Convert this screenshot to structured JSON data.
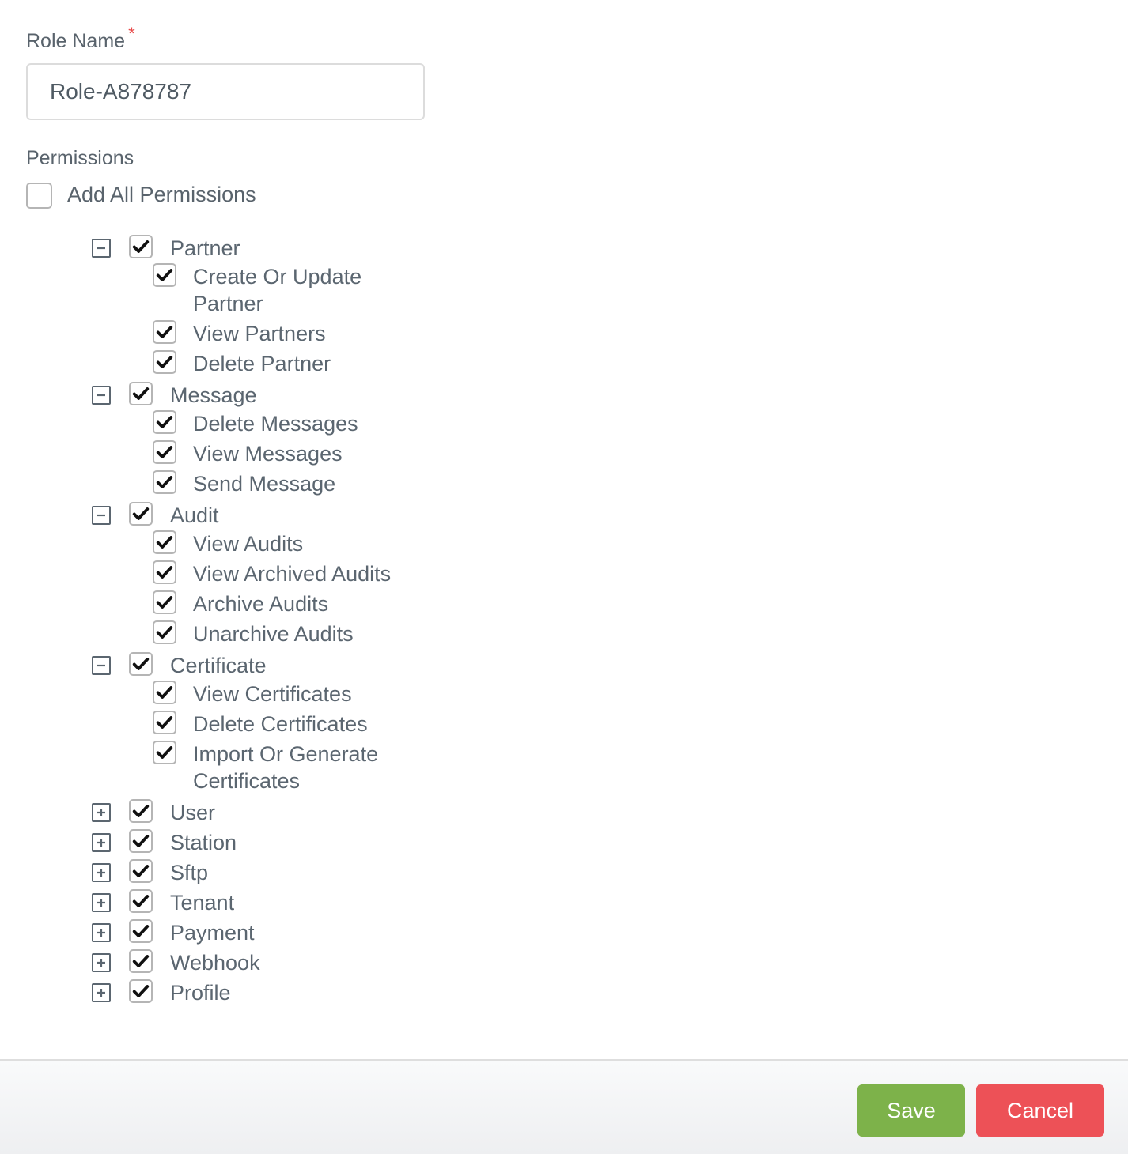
{
  "role_name": {
    "label": "Role Name",
    "required_marker": "*",
    "value": "Role-A878787"
  },
  "permissions": {
    "label": "Permissions",
    "add_all": {
      "label": "Add All Permissions",
      "checked": false
    },
    "groups": [
      {
        "label": "Partner",
        "expanded": true,
        "checked": true,
        "children": [
          {
            "label_lines": [
              "Create Or Update",
              "Partner"
            ],
            "checked": true
          },
          {
            "label_lines": [
              "View Partners"
            ],
            "checked": true
          },
          {
            "label_lines": [
              "Delete Partner"
            ],
            "checked": true
          }
        ]
      },
      {
        "label": "Message",
        "expanded": true,
        "checked": true,
        "children": [
          {
            "label_lines": [
              "Delete Messages"
            ],
            "checked": true
          },
          {
            "label_lines": [
              "View Messages"
            ],
            "checked": true
          },
          {
            "label_lines": [
              "Send Message"
            ],
            "checked": true
          }
        ]
      },
      {
        "label": "Audit",
        "expanded": true,
        "checked": true,
        "children": [
          {
            "label_lines": [
              "View Audits"
            ],
            "checked": true
          },
          {
            "label_lines": [
              "View Archived Audits"
            ],
            "checked": true
          },
          {
            "label_lines": [
              "Archive Audits"
            ],
            "checked": true
          },
          {
            "label_lines": [
              "Unarchive Audits"
            ],
            "checked": true
          }
        ]
      },
      {
        "label": "Certificate",
        "expanded": true,
        "checked": true,
        "children": [
          {
            "label_lines": [
              "View Certificates"
            ],
            "checked": true
          },
          {
            "label_lines": [
              "Delete Certificates"
            ],
            "checked": true
          },
          {
            "label_lines": [
              "Import Or Generate",
              "Certificates"
            ],
            "checked": true
          }
        ]
      },
      {
        "label": "User",
        "expanded": false,
        "checked": true,
        "children": []
      },
      {
        "label": "Station",
        "expanded": false,
        "checked": true,
        "children": []
      },
      {
        "label": "Sftp",
        "expanded": false,
        "checked": true,
        "children": []
      },
      {
        "label": "Tenant",
        "expanded": false,
        "checked": true,
        "children": []
      },
      {
        "label": "Payment",
        "expanded": false,
        "checked": true,
        "children": []
      },
      {
        "label": "Webhook",
        "expanded": false,
        "checked": true,
        "children": []
      },
      {
        "label": "Profile",
        "expanded": false,
        "checked": true,
        "children": []
      }
    ]
  },
  "footer": {
    "save_label": "Save",
    "cancel_label": "Cancel",
    "save_color": "#7db24a",
    "cancel_color": "#ed5157"
  }
}
